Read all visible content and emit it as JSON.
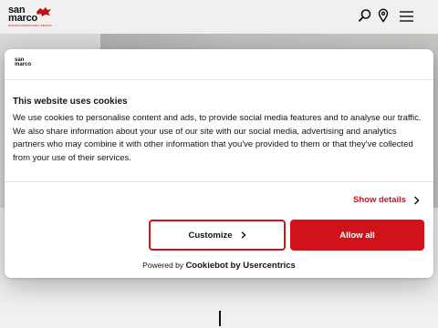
{
  "header": {
    "logo_line1": "san",
    "logo_line2": "marco",
    "logo_tagline": "NOSTRO DOMANI PER L'EDILIZIA",
    "icons": [
      "search-icon",
      "map-pin-icon",
      "hamburger-menu-icon"
    ]
  },
  "cookie_dialog": {
    "logo_text": "san marco",
    "title": "This website uses cookies",
    "body": "We use cookies to personalise content and ads, to provide social media features and to analyse our traffic. We also share information about your use of our site with our social media, advertising and analytics partners who may combine it with other information that you've provided to them or that they've collected from your use of their services.",
    "show_details_label": "Show details",
    "customize_label": "Customize",
    "allow_all_label": "Allow all",
    "powered_by_prefix": "Powered by",
    "powered_by_brand": "Cookiebot by Usercentrics"
  },
  "colors": {
    "accent": "#d0121b",
    "text": "#141414",
    "background": "#ffffff"
  }
}
